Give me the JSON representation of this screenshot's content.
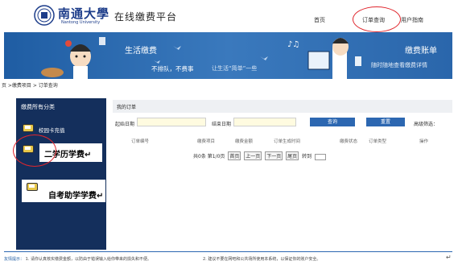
{
  "header": {
    "logo_title": "南通大學",
    "logo_subtitle": "Nantong University",
    "platform_title": "在线缴费平台",
    "nav": {
      "home": "首页",
      "orders": "订单查询",
      "guide": "用户指南"
    }
  },
  "banner": {
    "left_title": "生活缴费",
    "left_slogan": "不排队，不费事",
    "left_slogan2": "让生活“简单”一些",
    "right_title": "缴费账单",
    "right_slogan": "随时随地查看缴费详情"
  },
  "breadcrumb": "页 >缴费项目 > 订单查询",
  "sidebar": {
    "heading": "缴费所有分类",
    "items": [
      {
        "label": "校园卡充值"
      },
      {
        "label": "二学历学费↵"
      },
      {
        "label": "自考助学学费↵"
      }
    ]
  },
  "main": {
    "heading": "我的订单",
    "filters": {
      "start_label": "起始日期",
      "end_label": "结束日期",
      "query_button": "查询",
      "reset_button": "重置",
      "advanced": "高级筛选："
    },
    "columns": [
      "订单编号",
      "缴费项目",
      "缴费金额",
      "订单生成时间",
      "缴费状态",
      "订单类型",
      "操作"
    ],
    "pagination": {
      "summary": "共0条 第1/0页",
      "first": "首页",
      "prev": "上一页",
      "next": "下一页",
      "last": "尾页",
      "goto": "转到"
    }
  },
  "footer": {
    "tips_label": "友情提示：",
    "tips_1": "1. 请你认真核实缴费金额，以防由于错误输入给你带来的损失和不便。",
    "tips_2": "2. 建议不要在网吧和公共场所使用本系统，以保证你的账户安全。",
    "return_mark": "↵"
  },
  "colors": {
    "brand_blue": "#1f5da3",
    "sidebar_bg": "#142f5c",
    "button_blue": "#2c67b1",
    "annotation_red": "#e0262d"
  }
}
